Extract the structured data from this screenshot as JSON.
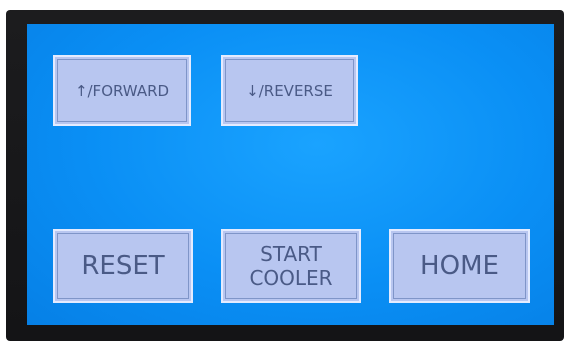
{
  "buttons": {
    "forward": "↑/FORWARD",
    "reverse": "↓/REVERSE",
    "reset": "RESET",
    "start_cooler_line1": "START",
    "start_cooler_line2": "COOLER",
    "home": "HOME"
  },
  "colors": {
    "screen": "#0a8ff5",
    "button_fill": "#b8c6f0",
    "button_text": "#4a5a86",
    "bezel": "#1c1c1e"
  }
}
